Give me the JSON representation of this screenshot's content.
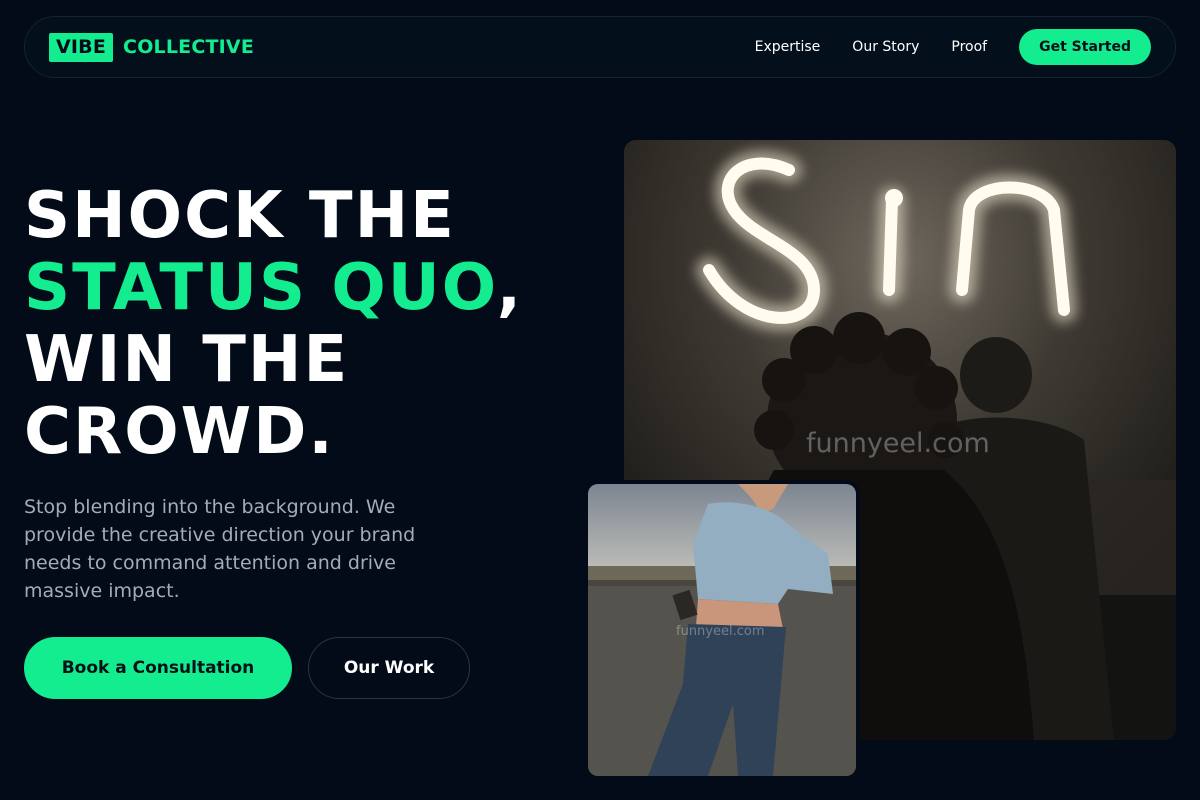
{
  "brand": {
    "box": "VIBE",
    "text": "COLLECTIVE"
  },
  "nav": {
    "links": [
      "Expertise",
      "Our Story",
      "Proof"
    ],
    "cta": "Get Started"
  },
  "hero": {
    "line1": "SHOCK THE",
    "line2_accent": "STATUS QUO",
    "line2_tail": ",",
    "line3": "WIN THE",
    "line4": "CROWD.",
    "subcopy": "Stop blending into the background. We provide the creative direction your brand needs to command attention and drive massive impact.",
    "primary_button": "Book a Consultation",
    "secondary_button": "Our Work"
  },
  "images": {
    "main_alt": "Neon 'Sin' sign with silhouetted people",
    "main_neon_text": "Sin",
    "main_watermark": "funnyeel.com",
    "small_alt": "Woman in denim jacket leaning against a wall",
    "small_watermark": "funnyeel.com"
  },
  "colors": {
    "background": "#020b17",
    "accent": "#13ec8f",
    "muted_text": "#a3acb9"
  }
}
